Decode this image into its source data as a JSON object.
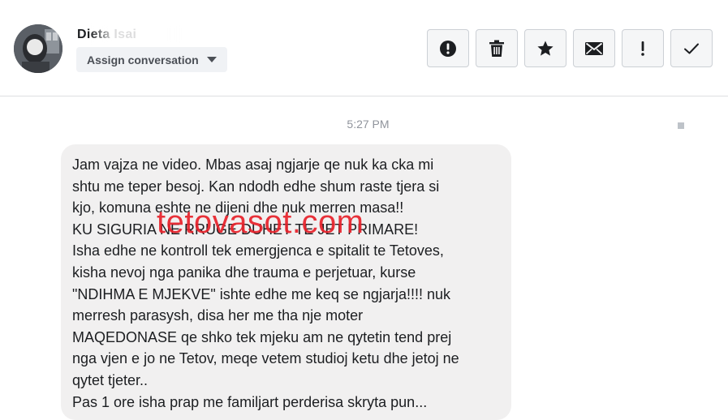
{
  "header": {
    "contact_name": "Dieta Isai",
    "assign_label": "Assign conversation",
    "actions": [
      {
        "name": "report-spam-button",
        "icon": "alert-circle-icon"
      },
      {
        "name": "delete-button",
        "icon": "trash-icon"
      },
      {
        "name": "star-button",
        "icon": "star-icon"
      },
      {
        "name": "mark-unread-button",
        "icon": "envelope-icon"
      },
      {
        "name": "mark-important-button",
        "icon": "exclamation-icon"
      },
      {
        "name": "mark-done-button",
        "icon": "check-icon"
      }
    ]
  },
  "conversation": {
    "timestamp": "5:27 PM",
    "message_lines": [
      "Jam vajza ne video. Mbas asaj ngjarje qe nuk ka cka mi",
      "shtu me teper besoj. Kan ndodh edhe shum raste tjera si",
      "kjo, komuna eshte ne dijeni dhe nuk merren masa!!",
      "KU SIGURIA NE RRUGE DUHET TE JET PRIMARE!",
      "Isha edhe ne kontroll tek emergjenca e spitalit te Tetoves,",
      "kisha nevoj nga panika dhe trauma e perjetuar, kurse",
      "\"NDIHMA E MJEKVE\" ishte edhe me keq se ngjarja!!!! nuk",
      "merresh parasysh, disa her me tha nje moter",
      "MAQEDONASE qe shko tek mjeku am ne qytetin tend prej",
      "nga vjen e jo ne Tetov, meqe vetem studioj ketu dhe jetoj ne",
      "qytet tjeter..",
      "Pas 1 ore isha prap me familjart perderisa skryta pun..."
    ]
  },
  "watermark": "tetovasot.com",
  "colors": {
    "watermark": "#e8212a",
    "bubble": "#f1f0f0",
    "text": "#1c1e21",
    "timestamp": "#90949c",
    "button_bg": "#f5f6f7",
    "button_border": "#ccd0d5"
  }
}
